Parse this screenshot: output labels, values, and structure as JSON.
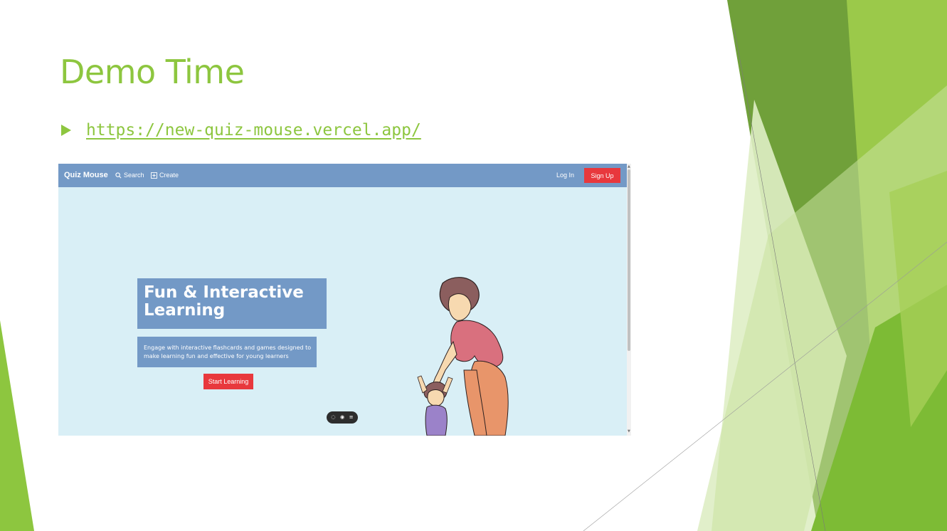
{
  "slide": {
    "title": "Demo Time",
    "link": "https://new-quiz-mouse.vercel.app/"
  },
  "app": {
    "brand": "Quiz Mouse",
    "nav": {
      "search": "Search",
      "create": "Create",
      "login": "Log In",
      "signup": "Sign Up"
    },
    "hero": {
      "title": "Fun & Interactive Learning",
      "subtitle": "Engage with interactive flashcards and games designed to make learning fun and effective for young learners",
      "cta": "Start Learning"
    },
    "toolbar_icons": [
      "chat-icon",
      "eye-icon",
      "menu-icon"
    ]
  },
  "colors": {
    "accent_green": "#8dc63f",
    "nav_blue": "#7399c6",
    "page_bg": "#d9eff6",
    "cta_red": "#e8383d"
  }
}
